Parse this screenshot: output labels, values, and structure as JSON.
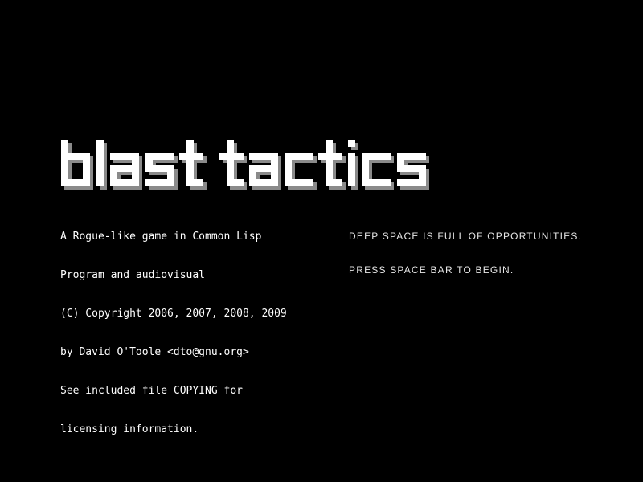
{
  "title_screen": {
    "logo_text": "blast tactics",
    "credits": [
      "A Rogue-like game in Common Lisp",
      "Program and audiovisual",
      "(C) Copyright 2006, 2007, 2008, 2009",
      "by David O'Toole <dto@gnu.org>",
      "See included file COPYING for",
      "licensing information."
    ],
    "message": [
      "DEEP SPACE IS FULL OF OPPORTUNITIES.",
      "PRESS SPACE BAR TO BEGIN."
    ]
  },
  "colors": {
    "background": "#000000",
    "logo_fill": "#ffffff",
    "logo_shadow": "#8a8a8a",
    "text": "#ffffff",
    "message_text": "#e6e6e6"
  }
}
